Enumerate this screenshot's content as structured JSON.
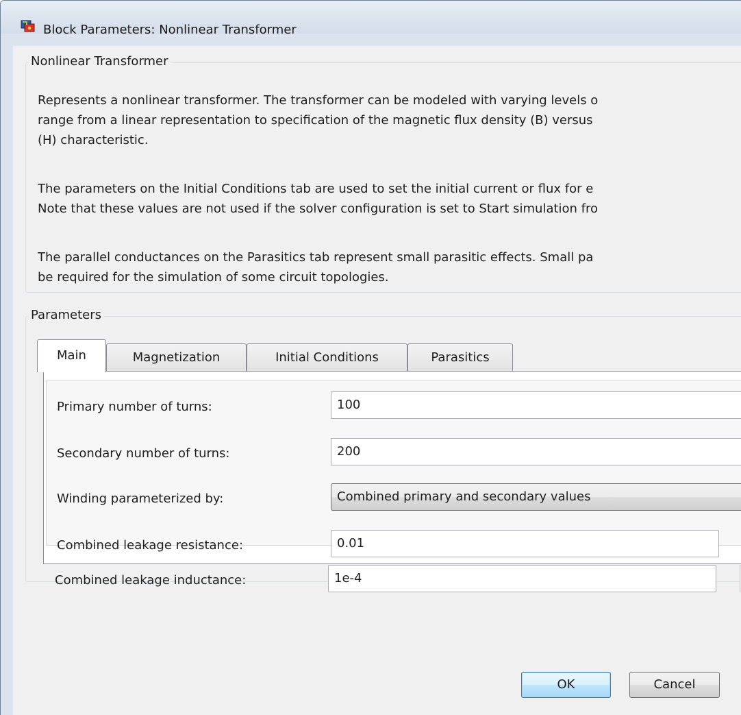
{
  "window": {
    "title": "Block Parameters: Nonlinear Transformer",
    "icon": "simulink-block-icon"
  },
  "description": {
    "legend": "Nonlinear Transformer",
    "paragraphs": [
      "Represents a nonlinear transformer. The transformer can be modeled with varying levels o\nrange from a linear representation to specification of the magnetic flux density (B) versus\n(H) characteristic.",
      "The parameters on the Initial Conditions tab are used to set the initial current or flux for e\nNote that these values are not used if the solver configuration is set to Start simulation fro",
      "The parallel conductances on the Parasitics tab represent small parasitic effects. Small pa\nbe required for the simulation of some circuit topologies."
    ]
  },
  "parameters": {
    "legend": "Parameters",
    "tabs": [
      {
        "label": "Main",
        "active": true
      },
      {
        "label": "Magnetization",
        "active": false
      },
      {
        "label": "Initial Conditions",
        "active": false
      },
      {
        "label": "Parasitics",
        "active": false
      }
    ],
    "rows": [
      {
        "label": "Primary number of turns:",
        "value": "100"
      },
      {
        "label": "Secondary number of turns:",
        "value": "200"
      },
      {
        "label": "Winding parameterized by:",
        "value": "Combined primary and secondary values"
      },
      {
        "label": "Combined leakage resistance:",
        "value": "0.01"
      },
      {
        "label": "Combined leakage inductance:",
        "value": "1e-4"
      }
    ]
  },
  "buttons": {
    "ok": "OK",
    "cancel": "Cancel"
  },
  "colors": {
    "default_button_border": "#3c7fb1",
    "panel_background": "#f0f0f0",
    "titlebar": "#dbe4ee"
  }
}
